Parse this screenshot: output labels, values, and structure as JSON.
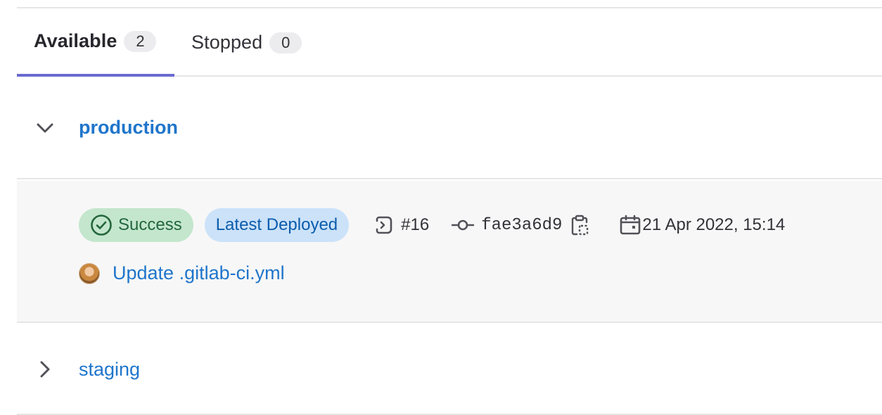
{
  "tabs": [
    {
      "label": "Available",
      "count": "2"
    },
    {
      "label": "Stopped",
      "count": "0"
    }
  ],
  "environments": {
    "production": {
      "name": "production",
      "status": "Success",
      "deployed_badge": "Latest Deployed",
      "deployment_id": "#16",
      "commit_sha": "fae3a6d9",
      "date": "21 Apr 2022, 15:14",
      "commit_title": "Update .gitlab-ci.yml"
    },
    "staging": {
      "name": "staging"
    }
  },
  "icons": {
    "expanded": "chevron-down-icon",
    "collapsed": "chevron-right-icon",
    "status": "check-circle-icon",
    "deployment": "rocket-icon",
    "commit": "commit-icon",
    "copy": "copy-to-clipboard-icon",
    "date": "calendar-icon"
  },
  "colors": {
    "accent": "#6a6ad0",
    "link": "#1f75cb",
    "success_bg": "#c3e6cd",
    "success_text": "#24663b",
    "info_bg": "#cbe2f9",
    "info_text": "#0b5cad"
  }
}
